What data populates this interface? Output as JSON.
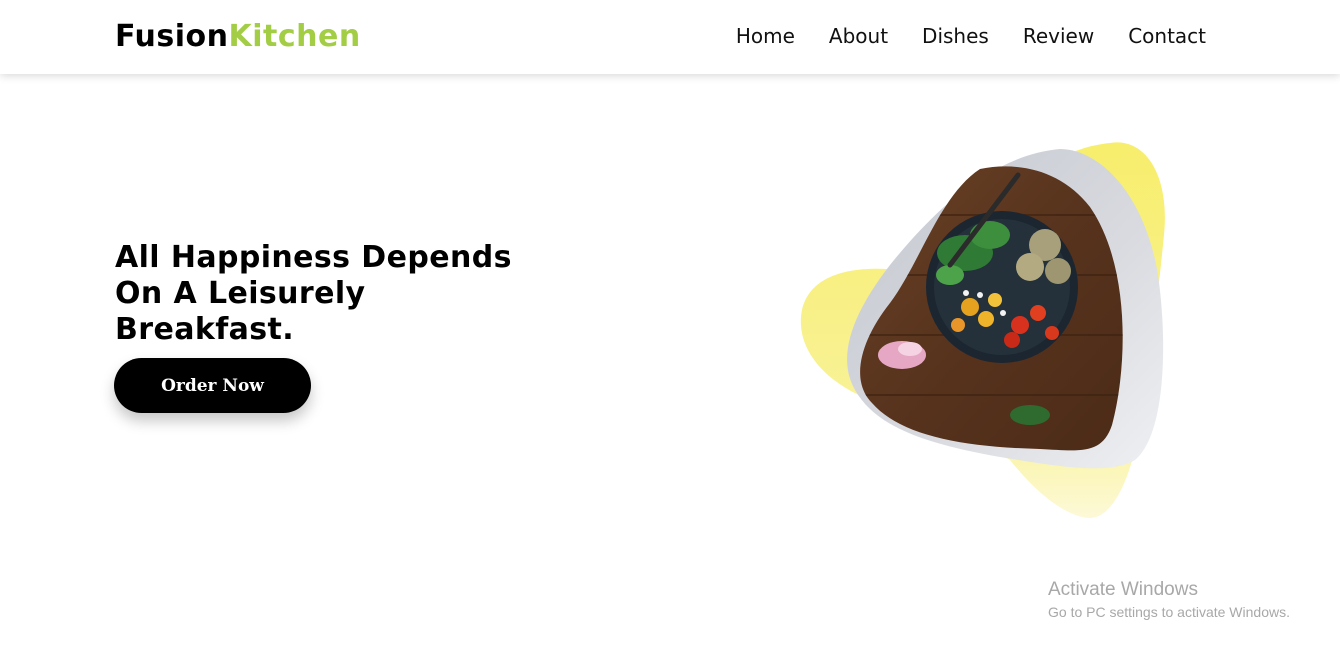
{
  "brand": {
    "name_primary": "Fusion",
    "name_accent": "Kitchen",
    "accent_color": "#a2cd45"
  },
  "nav": {
    "items": [
      "Home",
      "About",
      "Dishes",
      "Review",
      "Contact"
    ]
  },
  "hero": {
    "title": "All Happiness Depends On A Leisurely Breakfast.",
    "cta_label": "Order Now",
    "image_subject": "salad bowl with vegetables and fritters on wooden table"
  },
  "colors": {
    "blob": "#f7ec6a",
    "frame": "#c8cbd2",
    "button": "#000000"
  },
  "watermark": {
    "title": "Activate Windows",
    "subtitle": "Go to PC settings to activate Windows."
  }
}
